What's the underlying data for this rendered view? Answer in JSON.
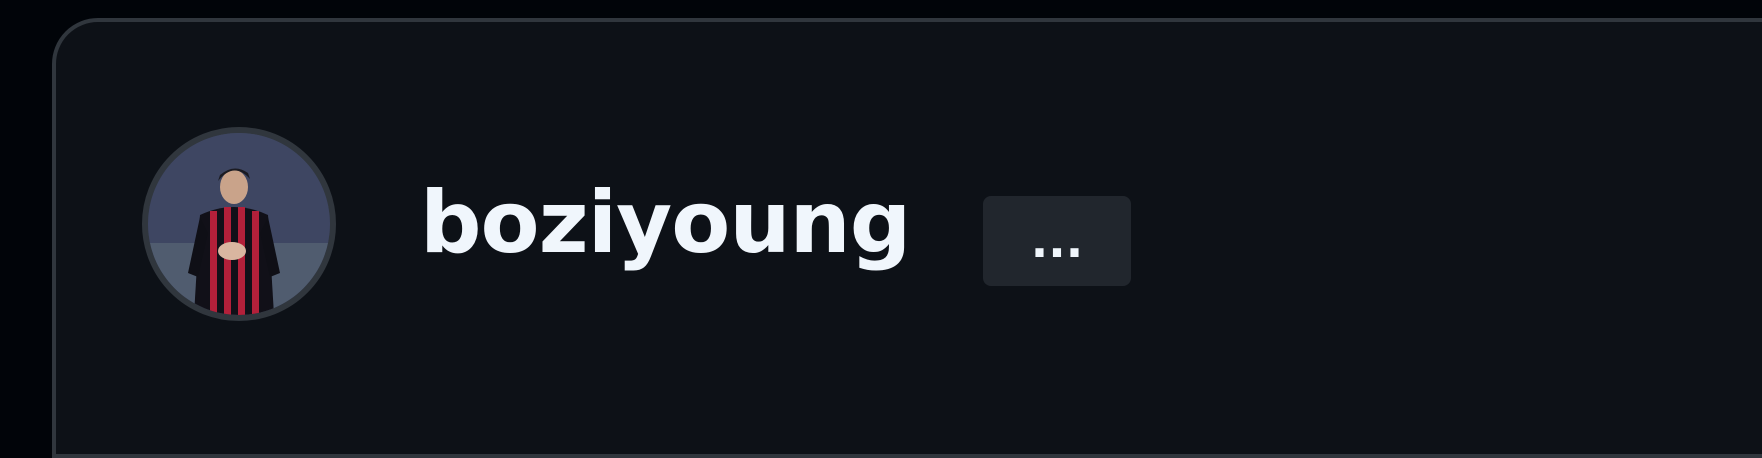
{
  "profile": {
    "username": "boziyoung",
    "avatar_icon": "user-avatar-photo",
    "more_button_label": "...",
    "more_icon": "ellipsis-icon"
  },
  "colors": {
    "page_background": "#010409",
    "card_background": "#0d1117",
    "card_border": "#30363d",
    "username_text": "#f0f6fc",
    "button_background": "#21262d"
  }
}
